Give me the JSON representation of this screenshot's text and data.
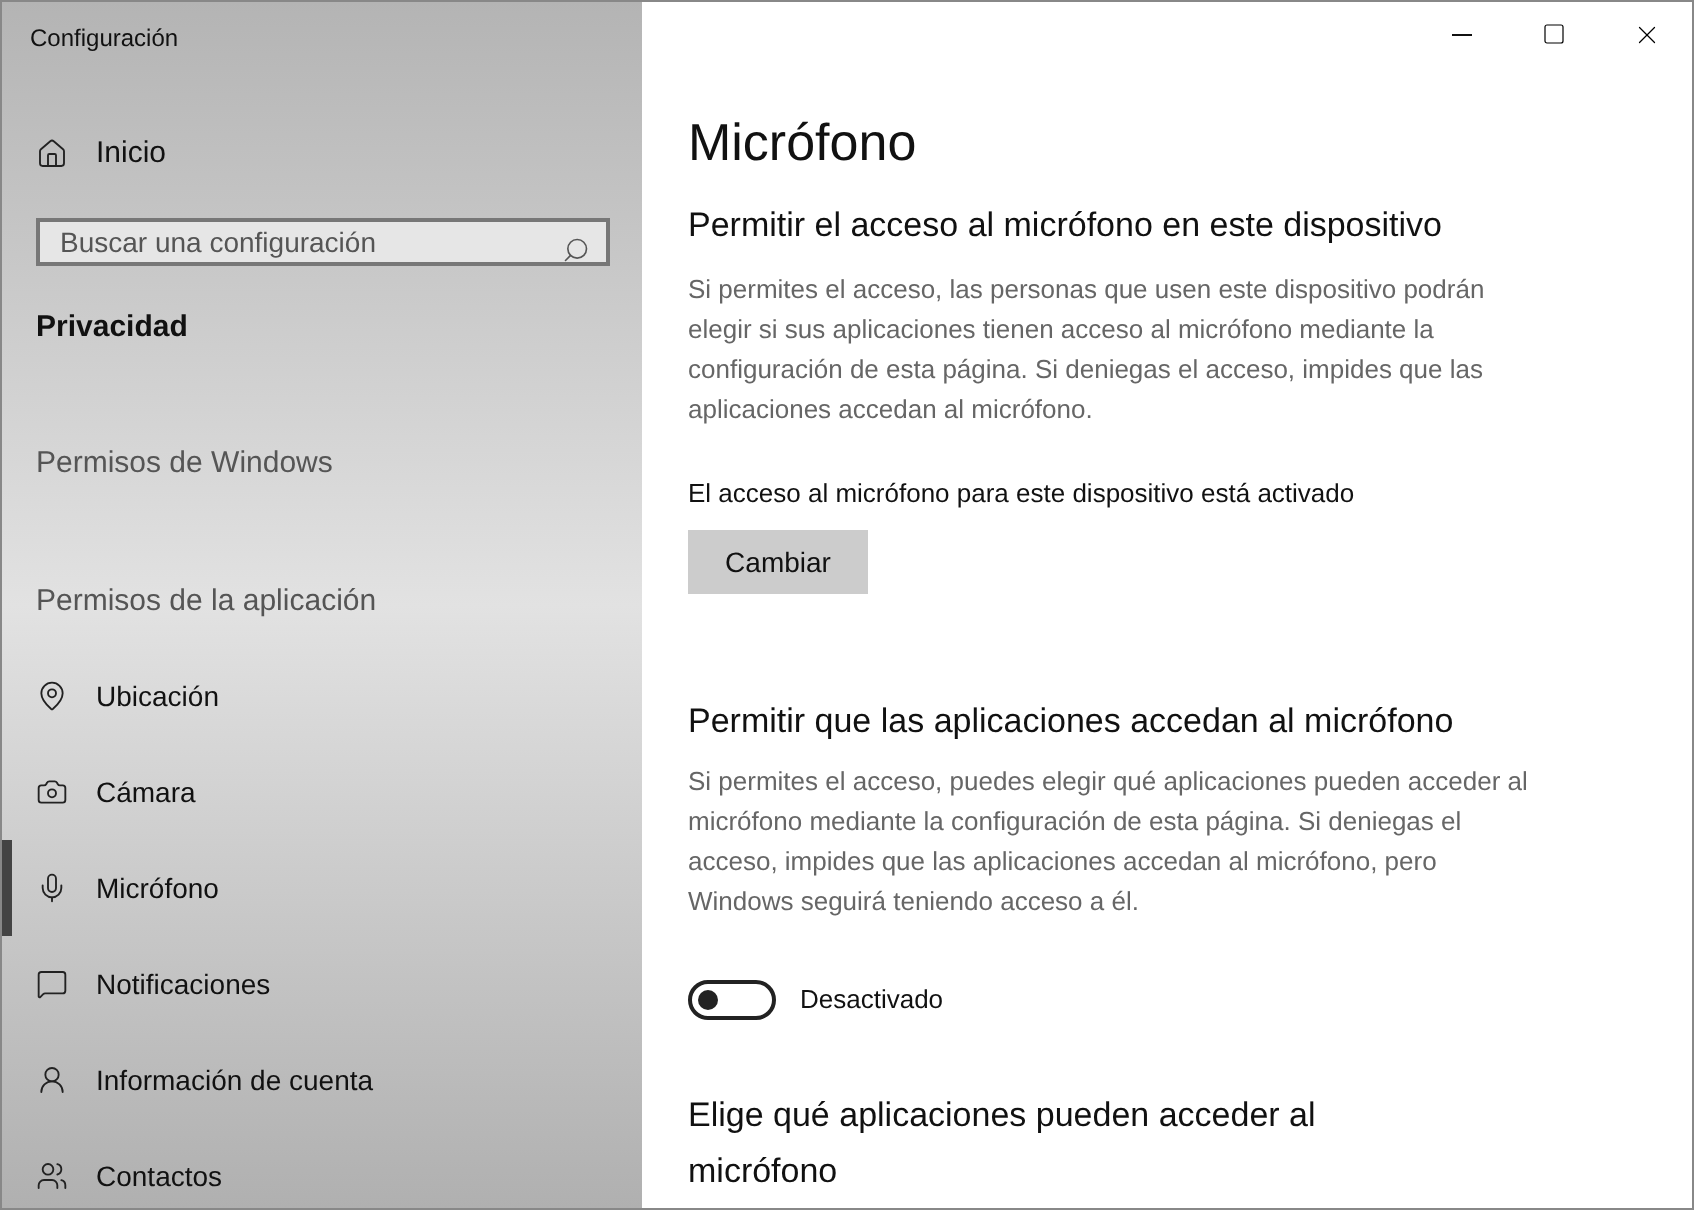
{
  "window": {
    "title": "Configuración"
  },
  "sidebar": {
    "home": "Inicio",
    "search": {
      "placeholder": "Buscar una configuración"
    },
    "category": "Privacidad",
    "groups": [
      {
        "title": "Permisos de Windows"
      },
      {
        "title": "Permisos de la aplicación",
        "items": [
          {
            "label": "Ubicación",
            "selected": false
          },
          {
            "label": "Cámara",
            "selected": false
          },
          {
            "label": "Micrófono",
            "selected": true
          },
          {
            "label": "Notificaciones",
            "selected": false
          },
          {
            "label": "Información de cuenta",
            "selected": false
          },
          {
            "label": "Contactos",
            "selected": false
          }
        ]
      }
    ]
  },
  "page": {
    "title": "Micrófono",
    "sections": [
      {
        "kind": "button",
        "heading": "Permitir el acceso al micrófono en este dispositivo",
        "description": "Si permites el acceso, las personas que usen este dispositivo podrán elegir si sus aplicaciones tienen acceso al micrófono mediante la configuración de esta página. Si deniegas el acceso, impides que las aplicaciones accedan al micrófono.",
        "status": "El acceso al micrófono para este dispositivo está activado",
        "button": "Cambiar"
      },
      {
        "kind": "toggle",
        "heading": "Permitir que las aplicaciones accedan al micrófono",
        "description": "Si permites el acceso, puedes elegir qué aplicaciones pueden acceder al micrófono mediante la configuración de esta página. Si deniegas el acceso, impides que las aplicaciones accedan al micrófono, pero Windows seguirá teniendo acceso a él.",
        "on": false,
        "toggle_label": "Desactivado"
      },
      {
        "kind": "heading",
        "heading": "Elige qué aplicaciones pueden acceder al micrófono"
      }
    ]
  }
}
